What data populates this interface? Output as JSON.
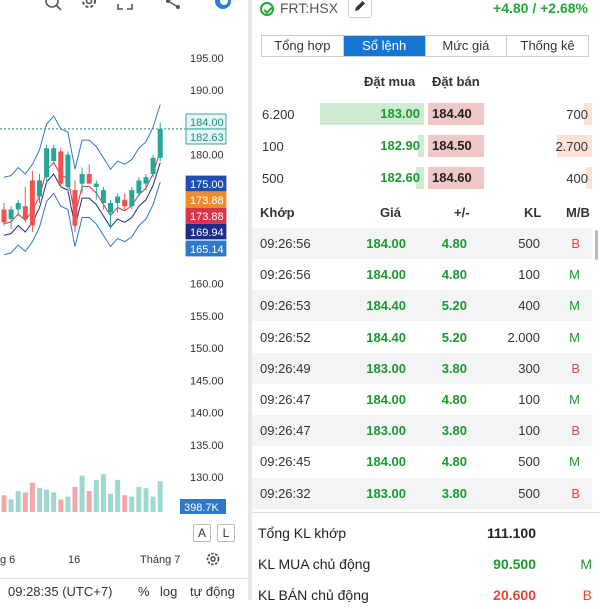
{
  "chart": {
    "toolbar_icons": [
      "indicator-icon",
      "gear-icon",
      "fullscreen-icon",
      "share-icon",
      "app-logo-icon"
    ],
    "y_ticks": [
      "195.00",
      "190.00",
      "185.00",
      "180.00",
      "175.00",
      "170.00",
      "165.00",
      "160.00",
      "155.00",
      "150.00",
      "145.00",
      "140.00",
      "135.00",
      "130.00"
    ],
    "price_tags": [
      {
        "label": "184.00",
        "bg": "#e6f6f4",
        "fg": "#1a8f84",
        "value": 184.0
      },
      {
        "label": "182.63",
        "bg": "#e6f6f4",
        "fg": "#1a8f84",
        "value": 182.63
      },
      {
        "label": "175.00",
        "bg": "#1f4fb3",
        "fg": "#ffffff",
        "value": 175.0
      },
      {
        "label": "173.88",
        "bg": "#ef8c2a",
        "fg": "#ffffff",
        "value": 173.88
      },
      {
        "label": "173.88",
        "bg": "#d8344c",
        "fg": "#ffffff",
        "value": 173.88
      },
      {
        "label": "169.94",
        "bg": "#1a2d8a",
        "fg": "#ffffff",
        "value": 169.94
      },
      {
        "label": "165.14",
        "bg": "#2e78c8",
        "fg": "#ffffff",
        "value": 165.14
      }
    ],
    "volume_tag": "398.7K",
    "x_labels": [
      "g 6",
      "16",
      "Tháng 7"
    ],
    "buttons": {
      "auto": "A",
      "log": "L"
    },
    "bottom": {
      "time": "09:28:35 (UTC+7)",
      "percent": "%",
      "log": "log",
      "auto": "tự động"
    }
  },
  "chart_data": {
    "type": "candlestick",
    "candles": [
      {
        "o": 171.5,
        "h": 172.5,
        "l": 169.0,
        "c": 169.5
      },
      {
        "o": 170.0,
        "h": 172.0,
        "l": 168.5,
        "c": 171.5
      },
      {
        "o": 171.5,
        "h": 173.0,
        "l": 170.5,
        "c": 172.5
      },
      {
        "o": 172.0,
        "h": 175.0,
        "l": 169.5,
        "c": 170.0
      },
      {
        "o": 176.0,
        "h": 177.5,
        "l": 168.0,
        "c": 169.0
      },
      {
        "o": 173.5,
        "h": 177.0,
        "l": 172.5,
        "c": 176.0
      },
      {
        "o": 176.5,
        "h": 181.5,
        "l": 175.5,
        "c": 181.0
      },
      {
        "o": 179.0,
        "h": 181.5,
        "l": 178.5,
        "c": 181.0
      },
      {
        "o": 180.5,
        "h": 181.0,
        "l": 175.0,
        "c": 175.5
      },
      {
        "o": 175.0,
        "h": 180.5,
        "l": 174.0,
        "c": 180.0
      },
      {
        "o": 174.5,
        "h": 176.0,
        "l": 168.0,
        "c": 169.0
      },
      {
        "o": 175.5,
        "h": 178.0,
        "l": 174.0,
        "c": 177.0
      },
      {
        "o": 177.0,
        "h": 178.5,
        "l": 175.5,
        "c": 175.5
      },
      {
        "o": 175.0,
        "h": 176.0,
        "l": 173.0,
        "c": 175.5
      },
      {
        "o": 172.5,
        "h": 175.0,
        "l": 171.5,
        "c": 174.5
      },
      {
        "o": 171.0,
        "h": 173.0,
        "l": 168.5,
        "c": 172.5
      },
      {
        "o": 172.5,
        "h": 174.0,
        "l": 171.0,
        "c": 173.5
      },
      {
        "o": 173.0,
        "h": 174.0,
        "l": 171.5,
        "c": 172.0
      },
      {
        "o": 172.0,
        "h": 175.0,
        "l": 171.5,
        "c": 174.5
      },
      {
        "o": 174.0,
        "h": 176.5,
        "l": 173.5,
        "c": 176.0
      },
      {
        "o": 175.5,
        "h": 177.0,
        "l": 174.5,
        "c": 176.5
      },
      {
        "o": 177.0,
        "h": 180.0,
        "l": 176.5,
        "c": 179.5
      },
      {
        "o": 179.5,
        "h": 185.0,
        "l": 179.0,
        "c": 184.0
      }
    ],
    "volumes": [
      120,
      90,
      150,
      140,
      210,
      170,
      160,
      140,
      90,
      110,
      180,
      260,
      150,
      230,
      270,
      130,
      230,
      120,
      110,
      180,
      170,
      110,
      220
    ],
    "ylim": [
      128,
      197
    ]
  },
  "ticker": {
    "symbol": "FRT:HSX",
    "change": "+4.80 / +2.68%"
  },
  "tabs": [
    {
      "label": "Tổng hợp",
      "active": false
    },
    {
      "label": "Sổ lệnh",
      "active": true
    },
    {
      "label": "Mức giá",
      "active": false
    },
    {
      "label": "Thống kê",
      "active": false
    }
  ],
  "orderbook": {
    "bid_header": "Đặt mua",
    "ask_header": "Đặt bán",
    "rows": [
      {
        "bid_vol": "6.200",
        "bid": "183.00",
        "ask": "184.40",
        "ask_vol": "700",
        "bid_fill": 1.0,
        "ask_fill": 0.1
      },
      {
        "bid_vol": "100",
        "bid": "182.90",
        "ask": "184.50",
        "ask_vol": "2.700",
        "bid_fill": 0.02,
        "ask_fill": 0.42
      },
      {
        "bid_vol": "500",
        "bid": "182.60",
        "ask": "184.60",
        "ask_vol": "400",
        "bid_fill": 0.08,
        "ask_fill": 0.06
      }
    ]
  },
  "trades": {
    "headers": {
      "time": "Khớp",
      "price": "Giá",
      "change": "+/-",
      "volume": "KL",
      "side": "M/B"
    },
    "rows": [
      {
        "time": "09:26:56",
        "price": "184.00",
        "change": "4.80",
        "volume": "500",
        "side": "B"
      },
      {
        "time": "09:26:56",
        "price": "184.00",
        "change": "4.80",
        "volume": "100",
        "side": "M"
      },
      {
        "time": "09:26:53",
        "price": "184.40",
        "change": "5.20",
        "volume": "400",
        "side": "M"
      },
      {
        "time": "09:26:52",
        "price": "184.40",
        "change": "5.20",
        "volume": "2.000",
        "side": "M"
      },
      {
        "time": "09:26:49",
        "price": "183.00",
        "change": "3.80",
        "volume": "300",
        "side": "B"
      },
      {
        "time": "09:26:47",
        "price": "184.00",
        "change": "4.80",
        "volume": "100",
        "side": "M"
      },
      {
        "time": "09:26:47",
        "price": "183.00",
        "change": "3.80",
        "volume": "100",
        "side": "B"
      },
      {
        "time": "09:26:45",
        "price": "184.00",
        "change": "4.80",
        "volume": "500",
        "side": "M"
      },
      {
        "time": "09:26:32",
        "price": "183.00",
        "change": "3.80",
        "volume": "500",
        "side": "B"
      }
    ]
  },
  "summary": [
    {
      "label": "Tổng KL khớp",
      "value": "111.100",
      "side": "",
      "color": "#222222"
    },
    {
      "label": "KL MUA chủ động",
      "value": "90.500",
      "side": "M",
      "color": "#1b9a2e"
    },
    {
      "label": "KL BÁN chủ động",
      "value": "20.600",
      "side": "B",
      "color": "#e0493a"
    }
  ]
}
